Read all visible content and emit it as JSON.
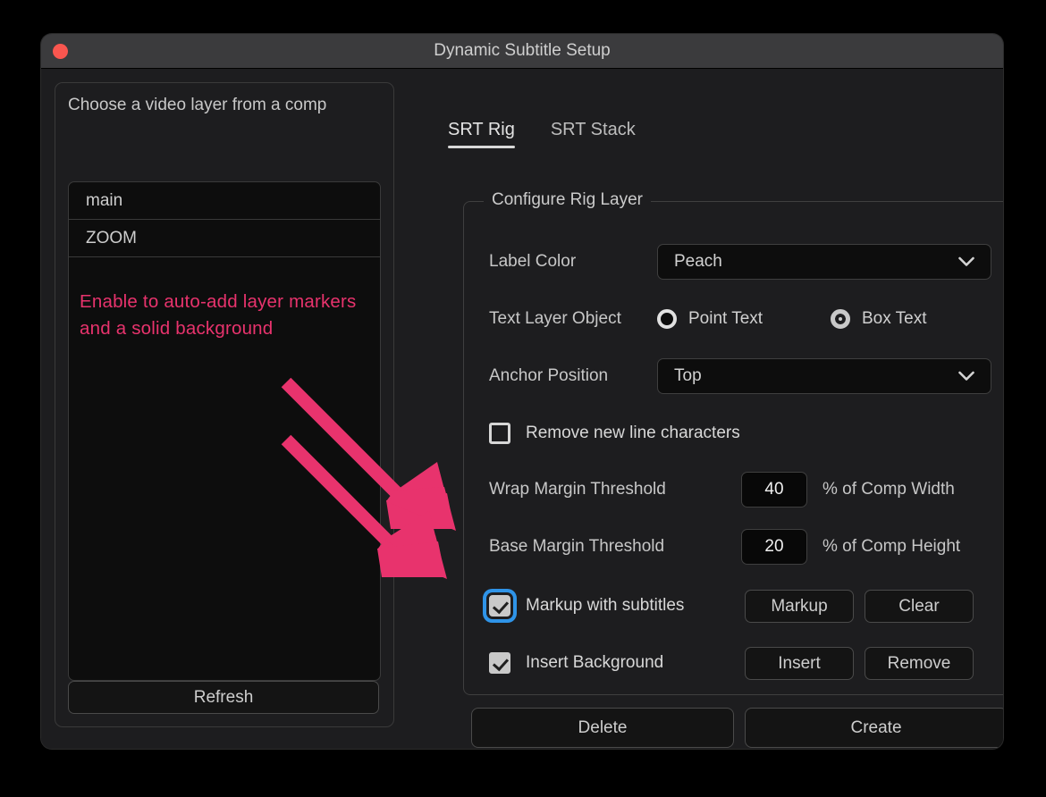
{
  "window": {
    "title": "Dynamic Subtitle Setup",
    "close_button": "close"
  },
  "left_panel": {
    "title": "Choose a video layer from a comp",
    "layers": [
      {
        "name": "main"
      },
      {
        "name": "ZOOM"
      }
    ],
    "refresh_label": "Refresh"
  },
  "annotation": {
    "text": "Enable to auto-add layer markers and a solid background",
    "color": "#e8336d",
    "arrow_count": 2
  },
  "tabs": [
    {
      "label": "SRT Rig",
      "active": true
    },
    {
      "label": "SRT Stack",
      "active": false
    }
  ],
  "group": {
    "legend": "Configure Rig Layer",
    "label_color": {
      "label": "Label Color",
      "value": "Peach",
      "icon": "chevron-down-icon"
    },
    "text_layer_object": {
      "label": "Text Layer Object",
      "options": [
        {
          "label": "Point Text",
          "selected": false
        },
        {
          "label": "Box Text",
          "selected": true
        }
      ]
    },
    "anchor_position": {
      "label": "Anchor Position",
      "value": "Top",
      "icon": "chevron-down-icon"
    },
    "remove_new_line": {
      "label": "Remove new line characters",
      "checked": false
    },
    "wrap_margin": {
      "label": "Wrap Margin Threshold",
      "value": "40",
      "unit": "% of Comp Width"
    },
    "base_margin": {
      "label": "Base Margin Threshold",
      "value": "20",
      "unit": "% of Comp Height"
    },
    "markup": {
      "label": "Markup with subtitles",
      "checked": true,
      "focused": true,
      "primary_button": "Markup",
      "secondary_button": "Clear"
    },
    "insert_background": {
      "label": "Insert Background",
      "checked": true,
      "focused": false,
      "primary_button": "Insert",
      "secondary_button": "Remove"
    }
  },
  "footer": {
    "delete_label": "Delete",
    "create_label": "Create"
  }
}
